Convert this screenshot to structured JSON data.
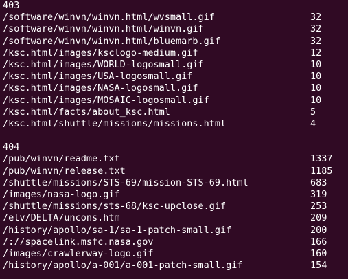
{
  "terminal": {
    "partial_top": "ypt",
    "sections": [
      {
        "code": "403",
        "rows": [
          {
            "path": "/software/winvn/winvn.html/wvsmall.gif",
            "count": "32"
          },
          {
            "path": "/software/winvn/winvn.html/winvn.gif",
            "count": "32"
          },
          {
            "path": "/software/winvn/winvn.html/bluemarb.gif",
            "count": "32"
          },
          {
            "path": "/ksc.html/images/ksclogo-medium.gif",
            "count": "12"
          },
          {
            "path": "/ksc.html/images/WORLD-logosmall.gif",
            "count": "10"
          },
          {
            "path": "/ksc.html/images/USA-logosmall.gif",
            "count": "10"
          },
          {
            "path": "/ksc.html/images/NASA-logosmall.gif",
            "count": "10"
          },
          {
            "path": "/ksc.html/images/MOSAIC-logosmall.gif",
            "count": "10"
          },
          {
            "path": "/ksc.html/facts/about_ksc.html",
            "count": "5"
          },
          {
            "path": "/ksc.html/shuttle/missions/missions.html",
            "count": "4"
          }
        ]
      },
      {
        "code": "404",
        "rows": [
          {
            "path": "/pub/winvn/readme.txt",
            "count": "1337"
          },
          {
            "path": "/pub/winvn/release.txt",
            "count": "1185"
          },
          {
            "path": "/shuttle/missions/STS-69/mission-STS-69.html",
            "count": "683"
          },
          {
            "path": "/images/nasa-logo.gif",
            "count": "319"
          },
          {
            "path": "/shuttle/missions/sts-68/ksc-upclose.gif",
            "count": "253"
          },
          {
            "path": "/elv/DELTA/uncons.htm",
            "count": "209"
          },
          {
            "path": "/history/apollo/sa-1/sa-1-patch-small.gif",
            "count": "200"
          },
          {
            "path": "/://spacelink.msfc.nasa.gov",
            "count": "166"
          },
          {
            "path": "/images/crawlerway-logo.gif",
            "count": "160"
          },
          {
            "path": "/history/apollo/a-001/a-001-patch-small.gif",
            "count": "154"
          }
        ]
      }
    ]
  },
  "colors": {
    "background": "#300a24",
    "text": "#ffffff"
  }
}
